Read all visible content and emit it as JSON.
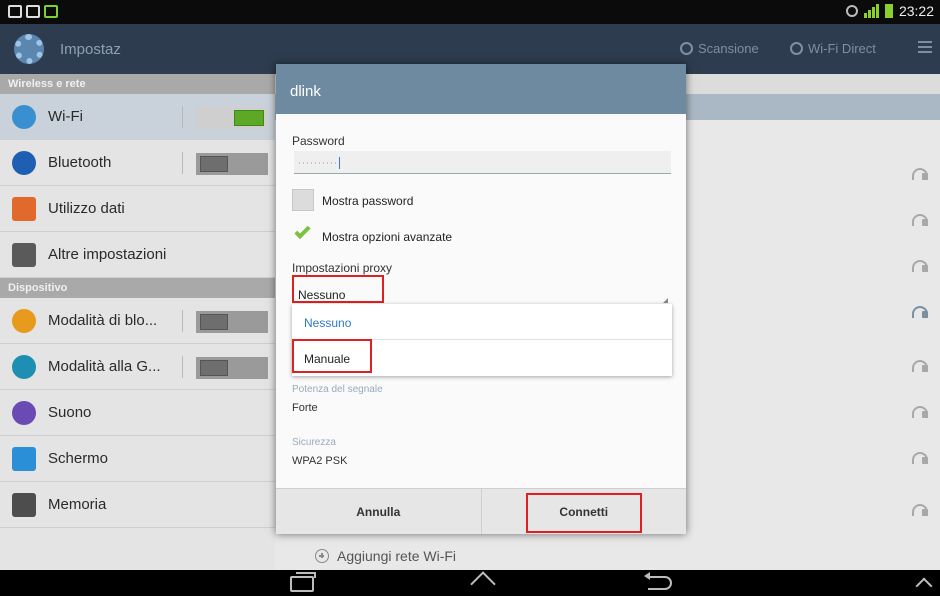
{
  "status_bar": {
    "time": "23:22"
  },
  "action_bar": {
    "title": "Impostaz",
    "scan_label": "Scansione",
    "wifi_direct_label": "Wi-Fi Direct"
  },
  "left_panel": {
    "section_wireless": "Wireless e rete",
    "section_device": "Dispositivo",
    "items": [
      {
        "label": "Wi-Fi",
        "icon": "wifi-icon",
        "color": "#3a8fd1",
        "toggle": "on"
      },
      {
        "label": "Bluetooth",
        "icon": "bluetooth-icon",
        "color": "#1e5fb3",
        "toggle": "off"
      },
      {
        "label": "Utilizzo dati",
        "icon": "data-usage-icon",
        "color": "#e0692b"
      },
      {
        "label": "Altre impostazioni",
        "icon": "more-settings-icon",
        "color": "#5a5a5a"
      },
      {
        "label": "Modalità di blo...",
        "icon": "blocking-mode-icon",
        "color": "#e79a1c",
        "toggle": "off"
      },
      {
        "label": "Modalità alla G...",
        "icon": "driving-mode-icon",
        "color": "#1e8fb3",
        "toggle": "off"
      },
      {
        "label": "Suono",
        "icon": "sound-icon",
        "color": "#6a4ab3"
      },
      {
        "label": "Schermo",
        "icon": "display-icon",
        "color": "#2a8fd6"
      },
      {
        "label": "Memoria",
        "icon": "storage-icon",
        "color": "#4d4d4d"
      }
    ]
  },
  "right_panel": {
    "add_network_label": "Aggiungi rete Wi-Fi"
  },
  "dialog": {
    "title": "dlink",
    "password_label": "Password",
    "password_value": "··········",
    "show_password_label": "Mostra password",
    "show_password_checked": false,
    "show_advanced_label": "Mostra opzioni avanzate",
    "show_advanced_checked": true,
    "proxy_label": "Impostazioni proxy",
    "proxy_value": "Nessuno",
    "proxy_options": [
      "Nessuno",
      "Manuale"
    ],
    "signal_label": "Potenza del segnale",
    "signal_value": "Forte",
    "security_label": "Sicurezza",
    "security_value": "WPA2 PSK",
    "cancel_label": "Annulla",
    "connect_label": "Connetti"
  },
  "colors": {
    "highlight_box": "#e02020",
    "dialog_title_bg": "#6e8aa1",
    "selected_option": "#2f7bc9",
    "checkmark": "#7cc242"
  }
}
